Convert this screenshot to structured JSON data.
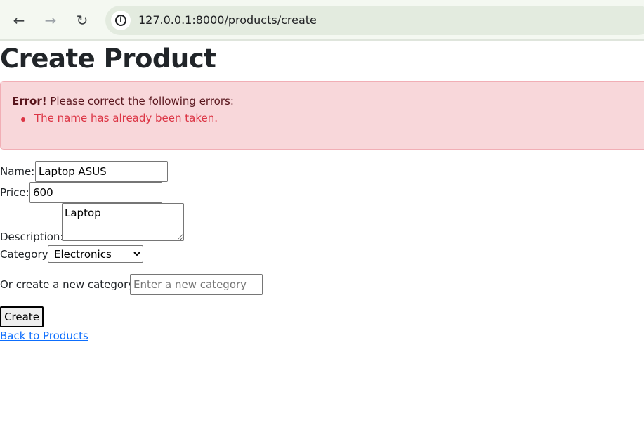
{
  "browser": {
    "url": "127.0.0.1:8000/products/create",
    "back_icon": "arrow-left",
    "forward_icon": "arrow-right",
    "reload_icon": "reload",
    "info_icon": "info-circle"
  },
  "page": {
    "title": "Create Product"
  },
  "alert": {
    "strong": "Error!",
    "message": "Please correct the following errors:",
    "errors": [
      "The name has already been taken."
    ],
    "bg_color": "#f8d7da",
    "error_color": "#dc3545"
  },
  "form": {
    "name": {
      "label": "Name:",
      "value": "Laptop ASUS"
    },
    "price": {
      "label": "Price:",
      "value": "600"
    },
    "description": {
      "label": "Description:",
      "value": "Laptop"
    },
    "category": {
      "label": "Category",
      "selected": "Electronics"
    },
    "new_category": {
      "label": "Or create a new category:",
      "placeholder": "Enter a new category"
    },
    "submit_label": "Create",
    "back_link": "Back to Products"
  }
}
